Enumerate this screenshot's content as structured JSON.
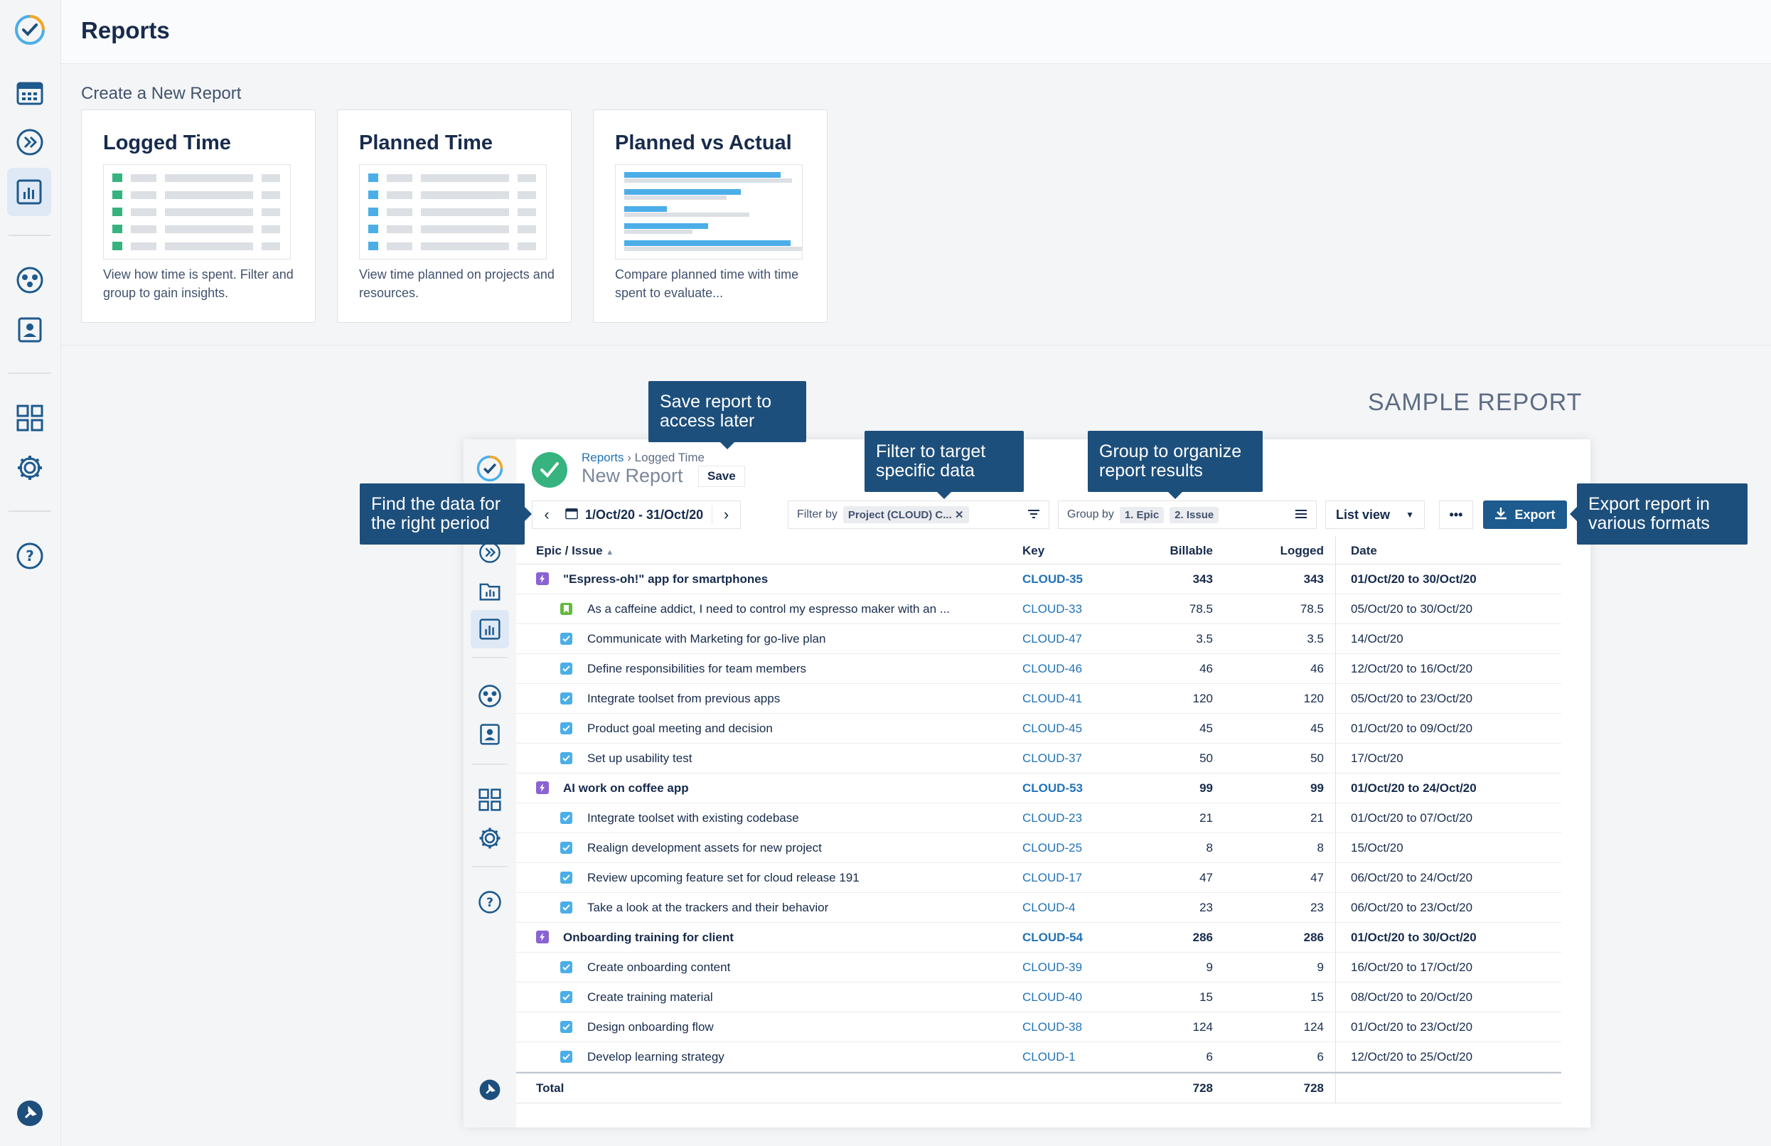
{
  "page": {
    "title": "Reports"
  },
  "create": {
    "heading": "Create a New Report",
    "cards": [
      {
        "title": "Logged Time",
        "desc": "View how time is spent. Filter and group to gain insights.",
        "accent": "#36b37e"
      },
      {
        "title": "Planned Time",
        "desc": "View time planned on projects and resources.",
        "accent": "#4baee8"
      },
      {
        "title": "Planned vs Actual",
        "desc": "Compare planned time with time spent to evaluate...",
        "accent": "#4baee8"
      }
    ]
  },
  "sample": {
    "label": "SAMPLE REPORT",
    "breadcrumb": {
      "root": "Reports",
      "current": "Logged Time"
    },
    "report_name": "New Report",
    "save_label": "Save",
    "period": "1/Oct/20 - 31/Oct/20",
    "filter_label": "Filter by",
    "filter_chip": "Project (CLOUD) C...",
    "group_label": "Group by",
    "group_chips": [
      "1. Epic",
      "2. Issue"
    ],
    "view_label": "List view",
    "more_label": "•••",
    "export_label": "Export",
    "columns": {
      "issue": "Epic / Issue",
      "key": "Key",
      "billable": "Billable",
      "logged": "Logged",
      "date": "Date"
    },
    "rows": [
      {
        "type": "epic",
        "issue": "\"Espress-oh!\" app for smartphones",
        "key": "CLOUD-35",
        "billable": "343",
        "logged": "343",
        "date": "01/Oct/20 to 30/Oct/20"
      },
      {
        "type": "story",
        "issue": "As a caffeine addict, I need to control my espresso maker with an ...",
        "key": "CLOUD-33",
        "billable": "78.5",
        "logged": "78.5",
        "date": "05/Oct/20 to 30/Oct/20"
      },
      {
        "type": "task",
        "issue": "Communicate with Marketing for go-live plan",
        "key": "CLOUD-47",
        "billable": "3.5",
        "logged": "3.5",
        "date": "14/Oct/20"
      },
      {
        "type": "task",
        "issue": "Define responsibilities for team members",
        "key": "CLOUD-46",
        "billable": "46",
        "logged": "46",
        "date": "12/Oct/20 to 16/Oct/20"
      },
      {
        "type": "task",
        "issue": "Integrate toolset from previous apps",
        "key": "CLOUD-41",
        "billable": "120",
        "logged": "120",
        "date": "05/Oct/20 to 23/Oct/20"
      },
      {
        "type": "task",
        "issue": "Product goal meeting and decision",
        "key": "CLOUD-45",
        "billable": "45",
        "logged": "45",
        "date": "01/Oct/20 to 09/Oct/20"
      },
      {
        "type": "task",
        "issue": "Set up usability test",
        "key": "CLOUD-37",
        "billable": "50",
        "logged": "50",
        "date": "17/Oct/20"
      },
      {
        "type": "epic",
        "issue": "AI work on coffee app",
        "key": "CLOUD-53",
        "billable": "99",
        "logged": "99",
        "date": "01/Oct/20 to 24/Oct/20"
      },
      {
        "type": "task",
        "issue": "Integrate toolset with existing codebase",
        "key": "CLOUD-23",
        "billable": "21",
        "logged": "21",
        "date": "01/Oct/20 to 07/Oct/20"
      },
      {
        "type": "task",
        "issue": "Realign development assets for new project",
        "key": "CLOUD-25",
        "billable": "8",
        "logged": "8",
        "date": "15/Oct/20"
      },
      {
        "type": "task",
        "issue": "Review upcoming feature set for cloud release 191",
        "key": "CLOUD-17",
        "billable": "47",
        "logged": "47",
        "date": "06/Oct/20 to 24/Oct/20"
      },
      {
        "type": "task",
        "issue": "Take a look at the trackers and their behavior",
        "key": "CLOUD-4",
        "billable": "23",
        "logged": "23",
        "date": "06/Oct/20 to 23/Oct/20"
      },
      {
        "type": "epic",
        "issue": "Onboarding training for client",
        "key": "CLOUD-54",
        "billable": "286",
        "logged": "286",
        "date": "01/Oct/20 to 30/Oct/20"
      },
      {
        "type": "task",
        "issue": "Create onboarding content",
        "key": "CLOUD-39",
        "billable": "9",
        "logged": "9",
        "date": "16/Oct/20 to 17/Oct/20"
      },
      {
        "type": "task",
        "issue": "Create training material",
        "key": "CLOUD-40",
        "billable": "15",
        "logged": "15",
        "date": "08/Oct/20 to 20/Oct/20"
      },
      {
        "type": "task",
        "issue": "Design onboarding flow",
        "key": "CLOUD-38",
        "billable": "124",
        "logged": "124",
        "date": "01/Oct/20 to 23/Oct/20"
      },
      {
        "type": "task",
        "issue": "Develop learning strategy",
        "key": "CLOUD-1",
        "billable": "6",
        "logged": "6",
        "date": "12/Oct/20 to 25/Oct/20"
      }
    ],
    "total": {
      "label": "Total",
      "billable": "728",
      "logged": "728"
    }
  },
  "callouts": {
    "save": "Save report to access later",
    "filter": "Filter to target specific data",
    "group": "Group to organize report results",
    "period": "Find the data for the right period",
    "export": "Export report in various formats"
  },
  "colors": {
    "brand": "#1d5a8e",
    "link": "#2173b8",
    "callout": "#1d4f7c",
    "success": "#36b37e"
  }
}
